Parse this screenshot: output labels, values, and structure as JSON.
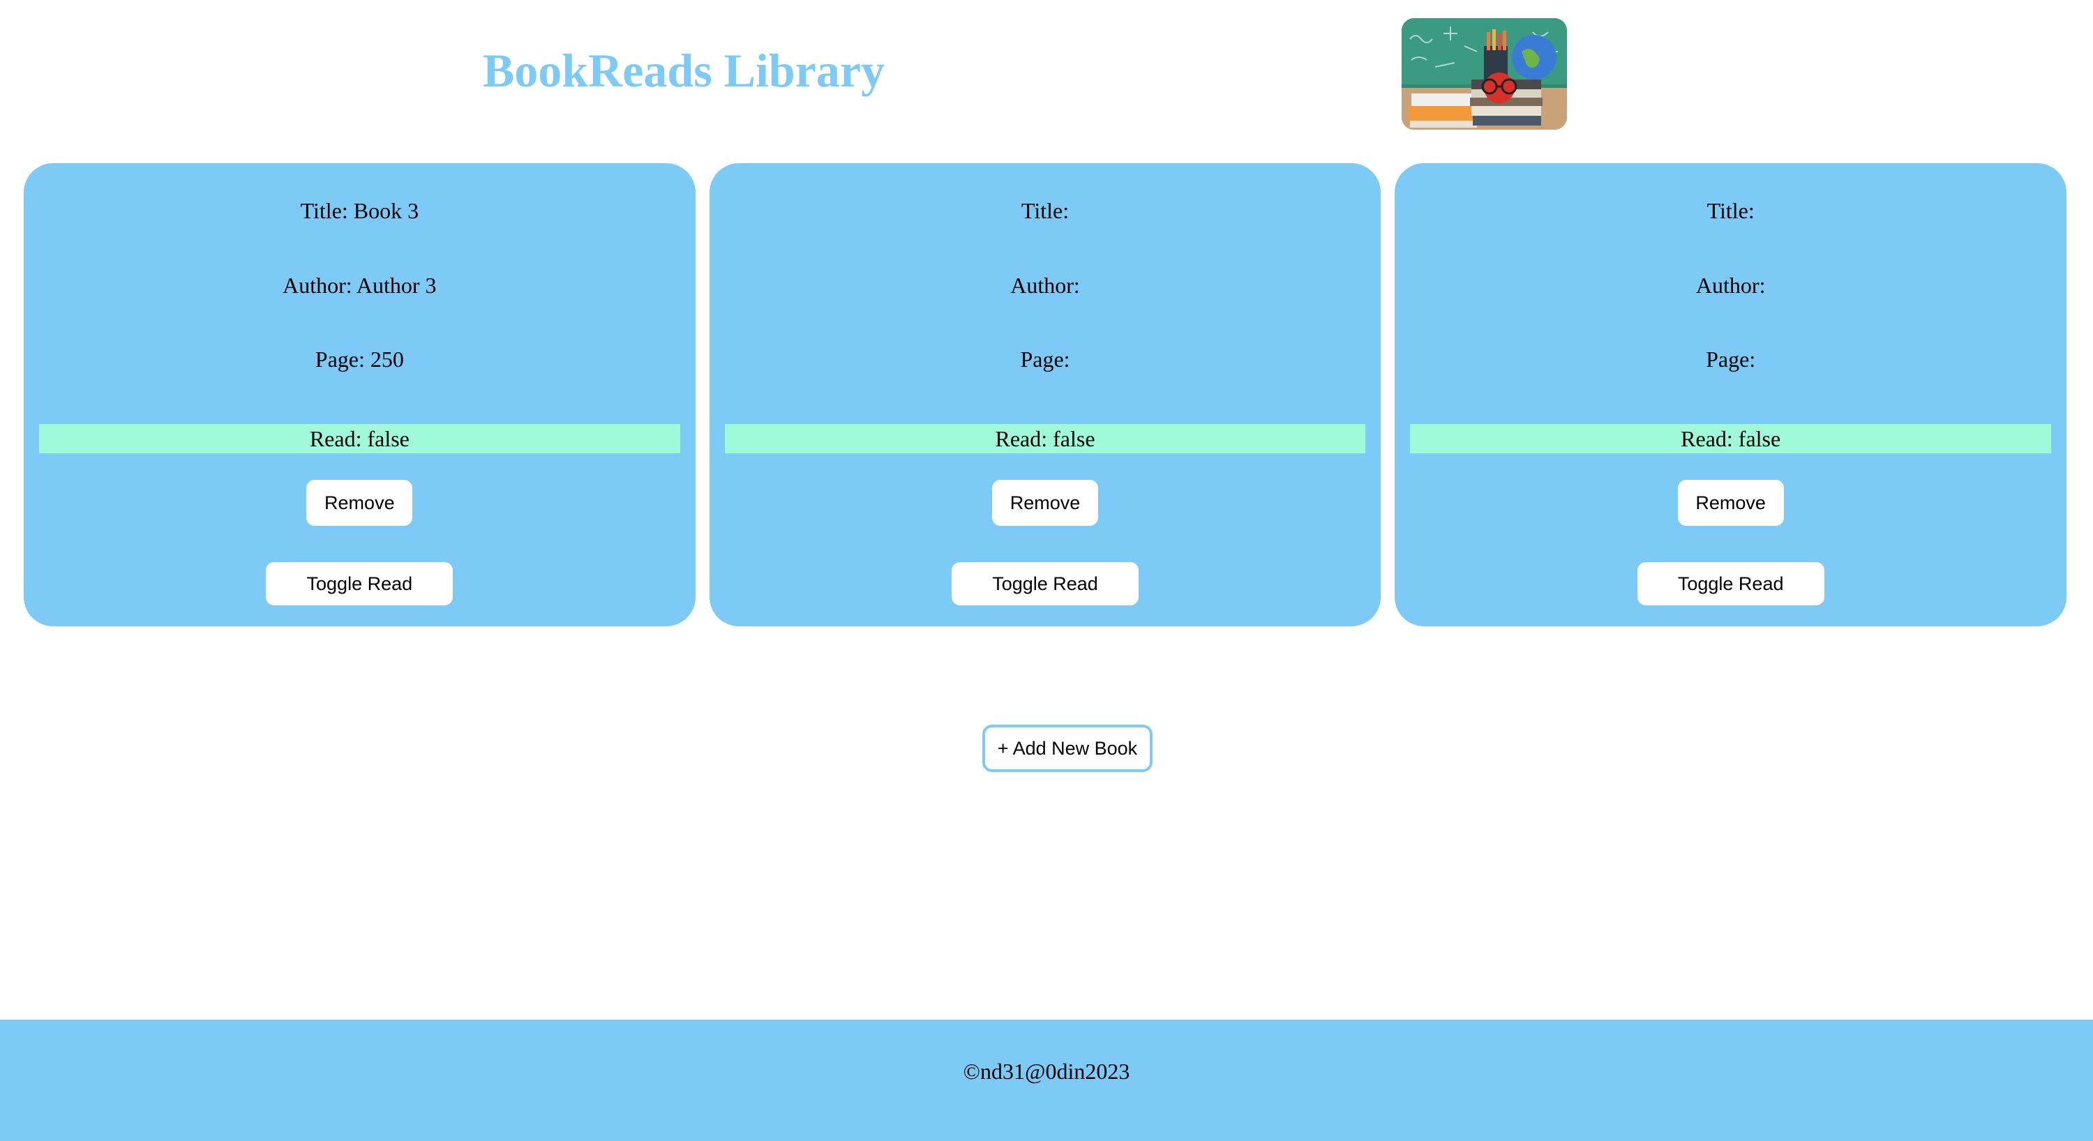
{
  "header": {
    "title": "BookReads Library",
    "logo_icon": "books-chalkboard-logo"
  },
  "colors": {
    "accent": "#7ecaf7",
    "read_bar": "#a0fad9",
    "button_bg": "#ffffff"
  },
  "books": [
    {
      "title_label": "Title: Book 3",
      "author_label": "Author: Author 3",
      "page_label": "Page: 250",
      "read_label": "Read: false",
      "remove_label": "Remove",
      "toggle_label": "Toggle Read"
    },
    {
      "title_label": "Title:",
      "author_label": "Author:",
      "page_label": "Page:",
      "read_label": "Read: false",
      "remove_label": "Remove",
      "toggle_label": "Toggle Read"
    },
    {
      "title_label": "Title:",
      "author_label": "Author:",
      "page_label": "Page:",
      "read_label": "Read: false",
      "remove_label": "Remove",
      "toggle_label": "Toggle Read"
    }
  ],
  "add_button_label": "+ Add New Book",
  "footer": {
    "text": "©nd31@0din2023"
  }
}
